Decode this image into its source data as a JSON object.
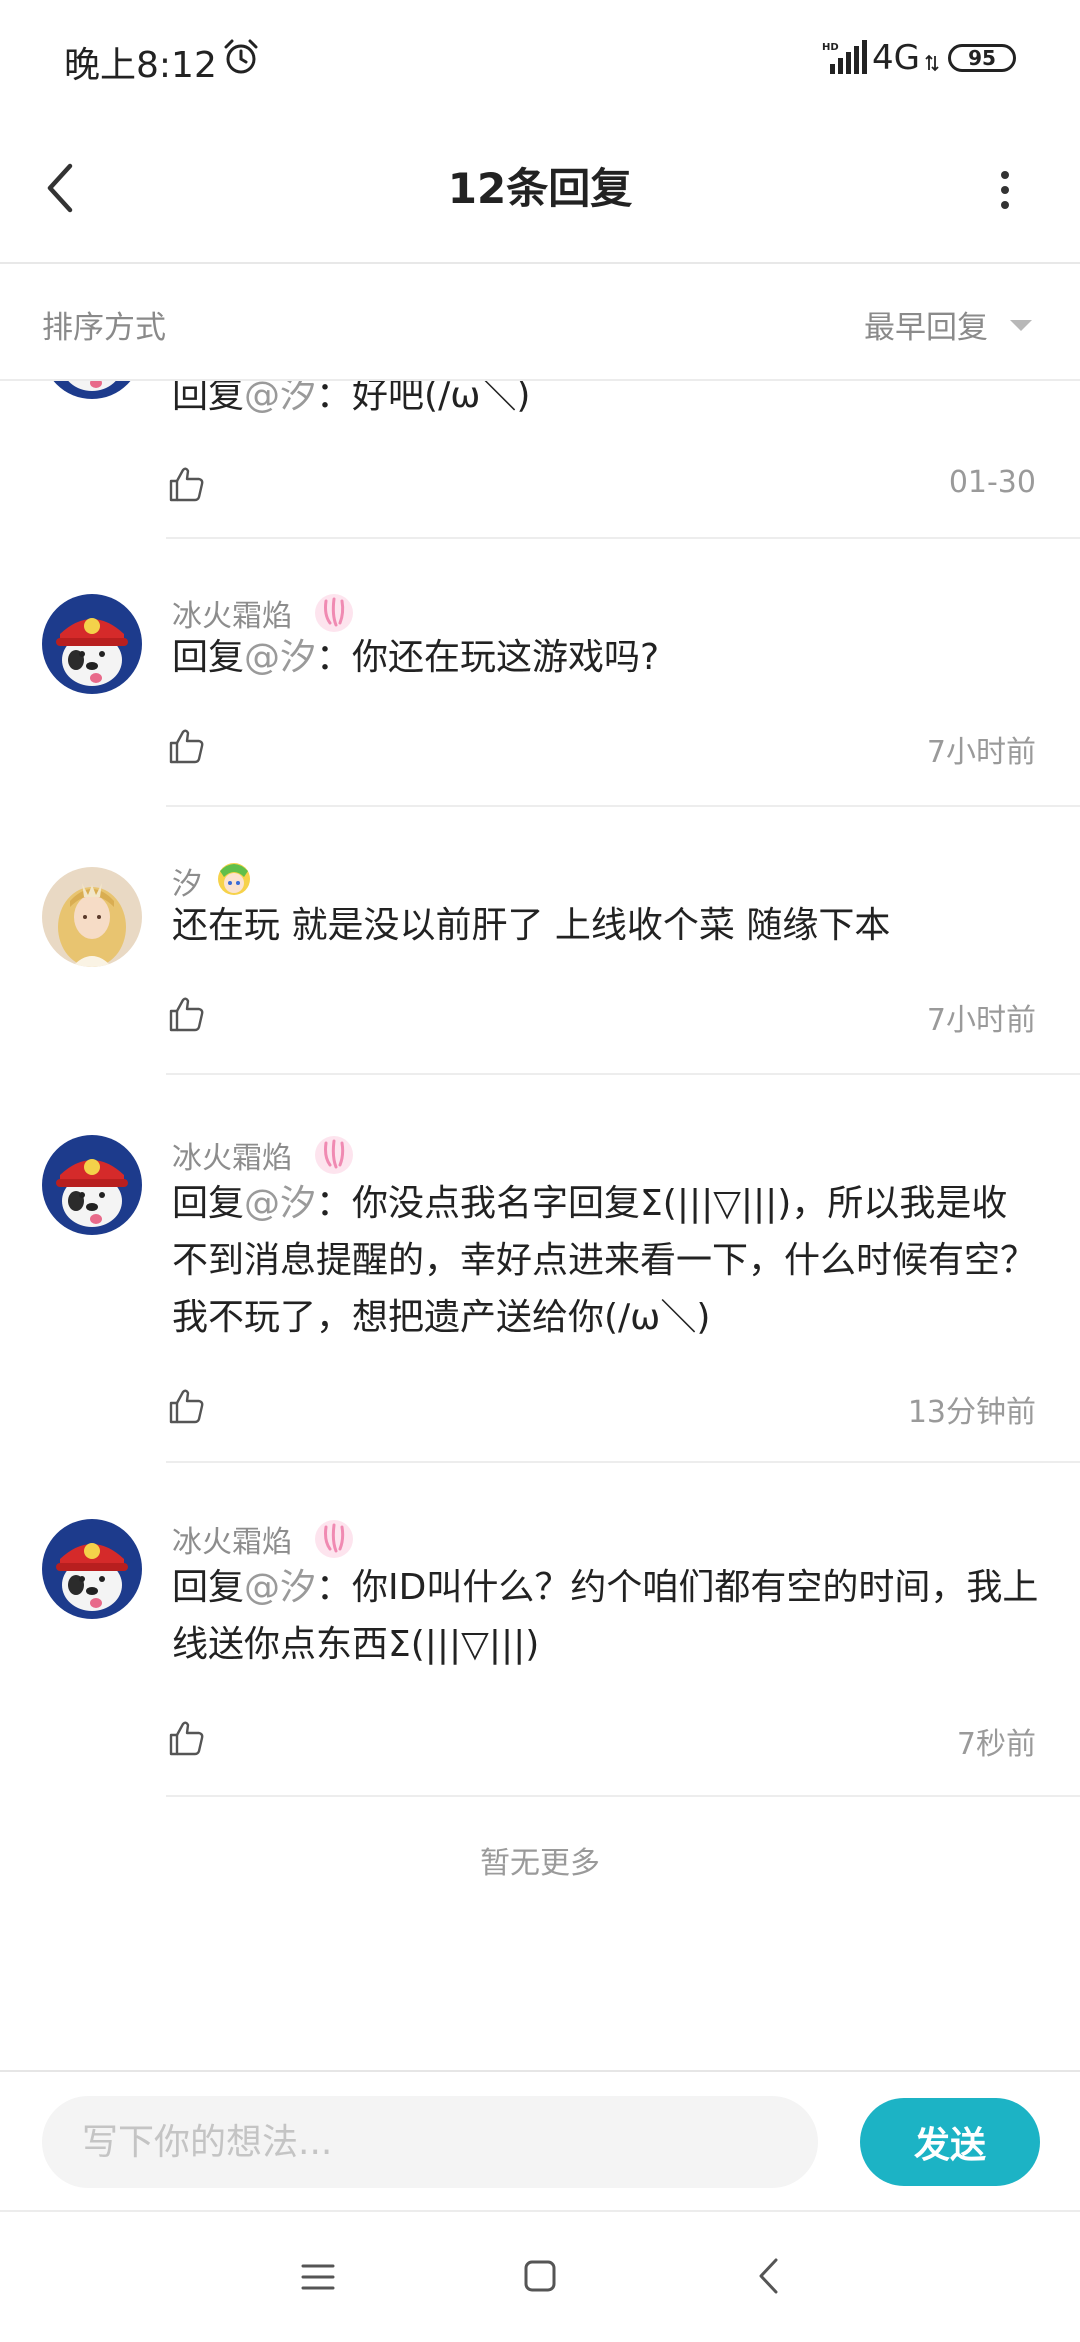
{
  "status_bar": {
    "time": "晚上8:12",
    "network": "4G",
    "battery": "95",
    "icons": [
      "alarm-icon",
      "signal-icon",
      "battery-icon"
    ]
  },
  "header": {
    "title": "12条回复",
    "icons": [
      "back-icon",
      "more-icon"
    ]
  },
  "sort": {
    "label": "排序方式",
    "value": "最早回复"
  },
  "comments": [
    {
      "reply_prefix": "回复",
      "mention": "@汐",
      "text": "：好吧(/ω＼)",
      "time": "01-30"
    },
    {
      "user": "冰火霜焰",
      "reply_prefix": "回复",
      "mention": "@汐",
      "text": "：你还在玩这游戏吗?",
      "time": "7小时前"
    },
    {
      "user": "汐",
      "text": "还在玩 就是没以前肝了 上线收个菜 随缘下本",
      "time": "7小时前"
    },
    {
      "user": "冰火霜焰",
      "reply_prefix": "回复",
      "mention": "@汐",
      "text": "：你没点我名字回复Σ(|||▽|||)，所以我是收不到消息提醒的，幸好点进来看一下，什么时候有空？我不玩了，想把遗产送给你(/ω＼)",
      "time": "13分钟前"
    },
    {
      "user": "冰火霜焰",
      "reply_prefix": "回复",
      "mention": "@汐",
      "text": "：你ID叫什么？约个咱们都有空的时间，我上线送你点东西Σ(|||▽|||)",
      "time": "7秒前"
    }
  ],
  "footer_note": "暂无更多",
  "input": {
    "placeholder": "写下你的想法...",
    "send_label": "发送"
  },
  "colors": {
    "accent": "#1cb3c5",
    "secondary_text": "#8d8d8d",
    "badge_pink": "#f3a3c4"
  }
}
